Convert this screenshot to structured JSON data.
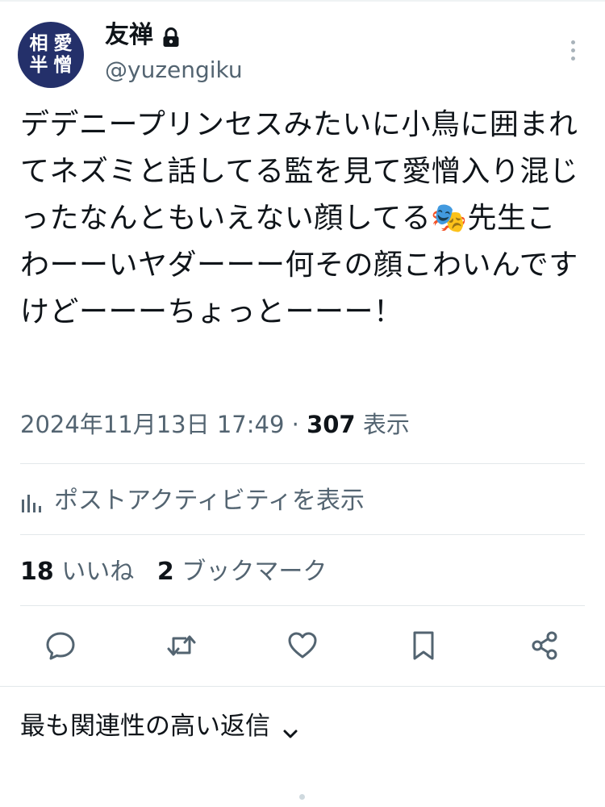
{
  "author": {
    "avatar_chars": [
      "相",
      "愛",
      "半",
      "憎"
    ],
    "display_name": "友禅",
    "handle": "@yuzengiku",
    "protected_icon": "lock-icon"
  },
  "tweet": {
    "text": "デデニープリンセスみたいに小鳥に囲まれてネズミと話してる監を見て愛憎入り混じったなんともいえない顔してる🎭先生こわーーいヤダーーー何その顔こわいんですけどーーーちょっとーーー！",
    "emoji_icon": "performing-arts-icon",
    "date": "2024年11月13日 17:49",
    "separator": " · ",
    "views_count": "307",
    "views_label": " 表示"
  },
  "activity": {
    "icon": "bar-chart-icon",
    "label": "ポストアクティビティを表示"
  },
  "stats": {
    "likes_count": "18",
    "likes_label": " いいね",
    "bookmarks_count": "2",
    "bookmarks_label": " ブックマーク"
  },
  "actions": [
    {
      "name": "reply",
      "icon": "reply-icon"
    },
    {
      "name": "repost",
      "icon": "repost-icon"
    },
    {
      "name": "like",
      "icon": "heart-icon"
    },
    {
      "name": "bookmark",
      "icon": "bookmark-icon"
    },
    {
      "name": "share",
      "icon": "share-icon"
    }
  ],
  "replies": {
    "sort_label": "最も関連性の高い返信"
  },
  "colors": {
    "text_primary": "#0f1419",
    "text_secondary": "#536471",
    "avatar_bg": "#24306a",
    "divider": "#e3e8ea"
  }
}
